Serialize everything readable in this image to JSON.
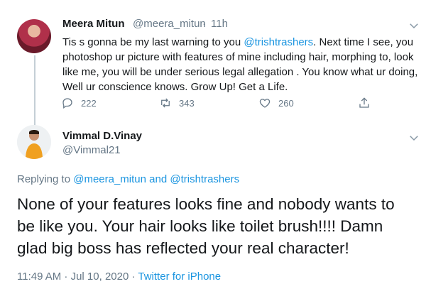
{
  "tweet1": {
    "display_name": "Meera Mitun",
    "handle": "@meera_mitun",
    "separator": "·",
    "time": "11h",
    "text_lines": [
      "Tis s gonna be my last warning to you ",
      "photoshop ur picture with features of mine including hair, morphing to, look",
      "like me, you will be under serious legal allegation . You know what ur doing,",
      "Well ur conscience knows. Grow Up! Get a Life."
    ],
    "mention": "@trishtrashers",
    "text_line1_tail": ". Next time I see, you",
    "replies_count": "222",
    "retweets_count": "343",
    "likes_count": "260"
  },
  "tweet2": {
    "display_name": "Vimmal D.Vinay",
    "handle": "@Vimmal21",
    "replying_prefix": "Replying to ",
    "replying_users": "@meera_mitun and @trishtrashers",
    "text_lines": [
      "None of your features looks fine and nobody wants to",
      "be like you. Your hair looks like toilet brush!!!! Damn",
      "glad big boss has reflected your real character!"
    ],
    "timestamp": "11:49 AM · Jul 10, 2020",
    "meta_separator": " · ",
    "source": "Twitter for iPhone"
  },
  "icons": [
    "reply-icon",
    "retweet-icon",
    "like-icon",
    "share-icon",
    "more-caret-icon"
  ],
  "colors": {
    "link": "#1b95e0",
    "muted": "#657786",
    "text": "#14171a"
  }
}
